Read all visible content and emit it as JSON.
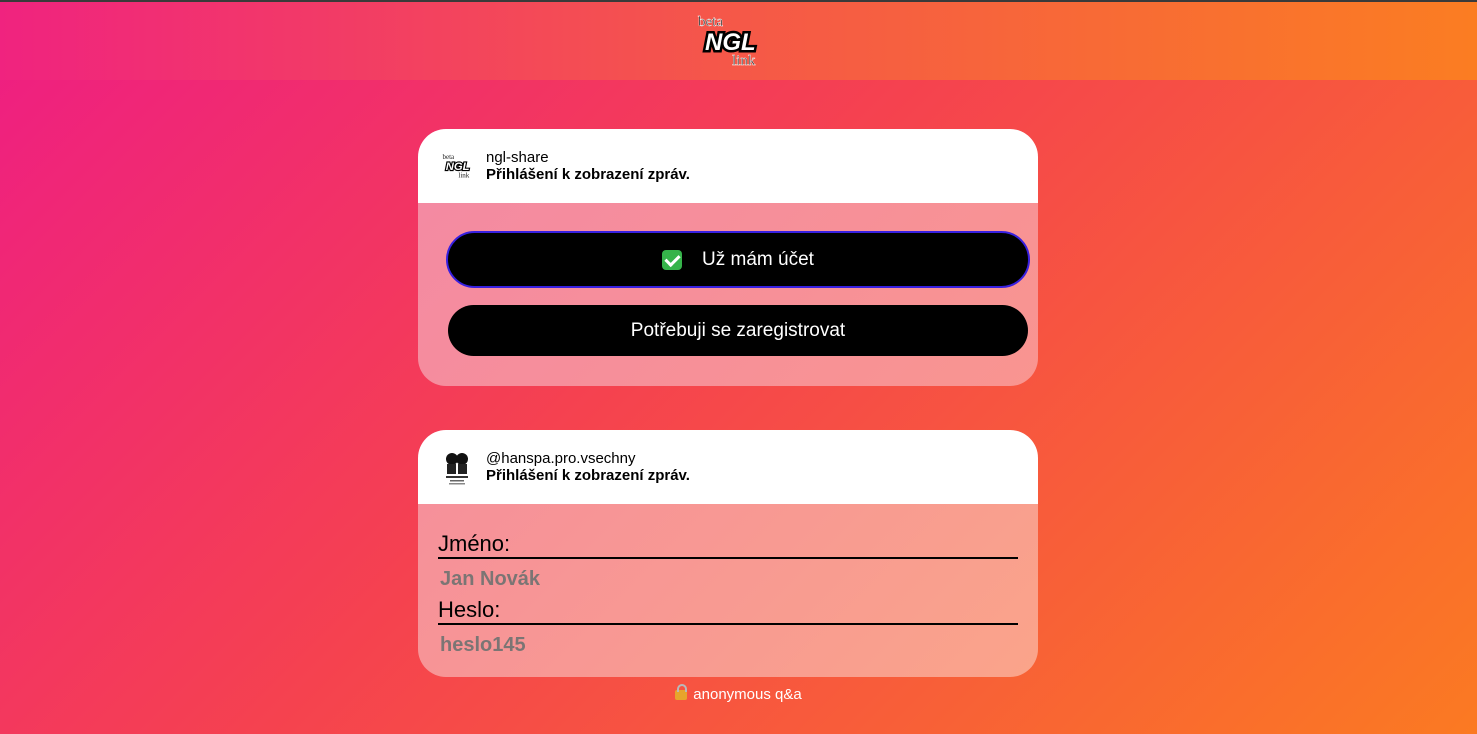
{
  "header": {
    "logo_top": "beta",
    "logo_main": "NGL",
    "logo_bottom": "link"
  },
  "card1": {
    "username": "ngl-share",
    "subtitle": "Přihlášení k zobrazení zpráv.",
    "btn_primary": "Už mám účet",
    "btn_secondary": "Potřebuji se zaregistrovat",
    "logo_top": "beta",
    "logo_main": "NGL",
    "logo_bottom": "link"
  },
  "card2": {
    "username": "@hanspa.pro.vsechny",
    "subtitle": "Přihlášení k zobrazení zpráv.",
    "name_label": "Jméno:",
    "name_value": "Jan Novák",
    "password_label": "Heslo:",
    "password_value": "heslo145"
  },
  "footer": {
    "text": "anonymous q&a"
  },
  "icons": {
    "check": "check-icon",
    "lock": "lock-icon",
    "avatar": "avatar-icon"
  },
  "colors": {
    "button_bg": "#000000",
    "button_focus_border": "#3820e0",
    "field_value": "#7b7574"
  }
}
